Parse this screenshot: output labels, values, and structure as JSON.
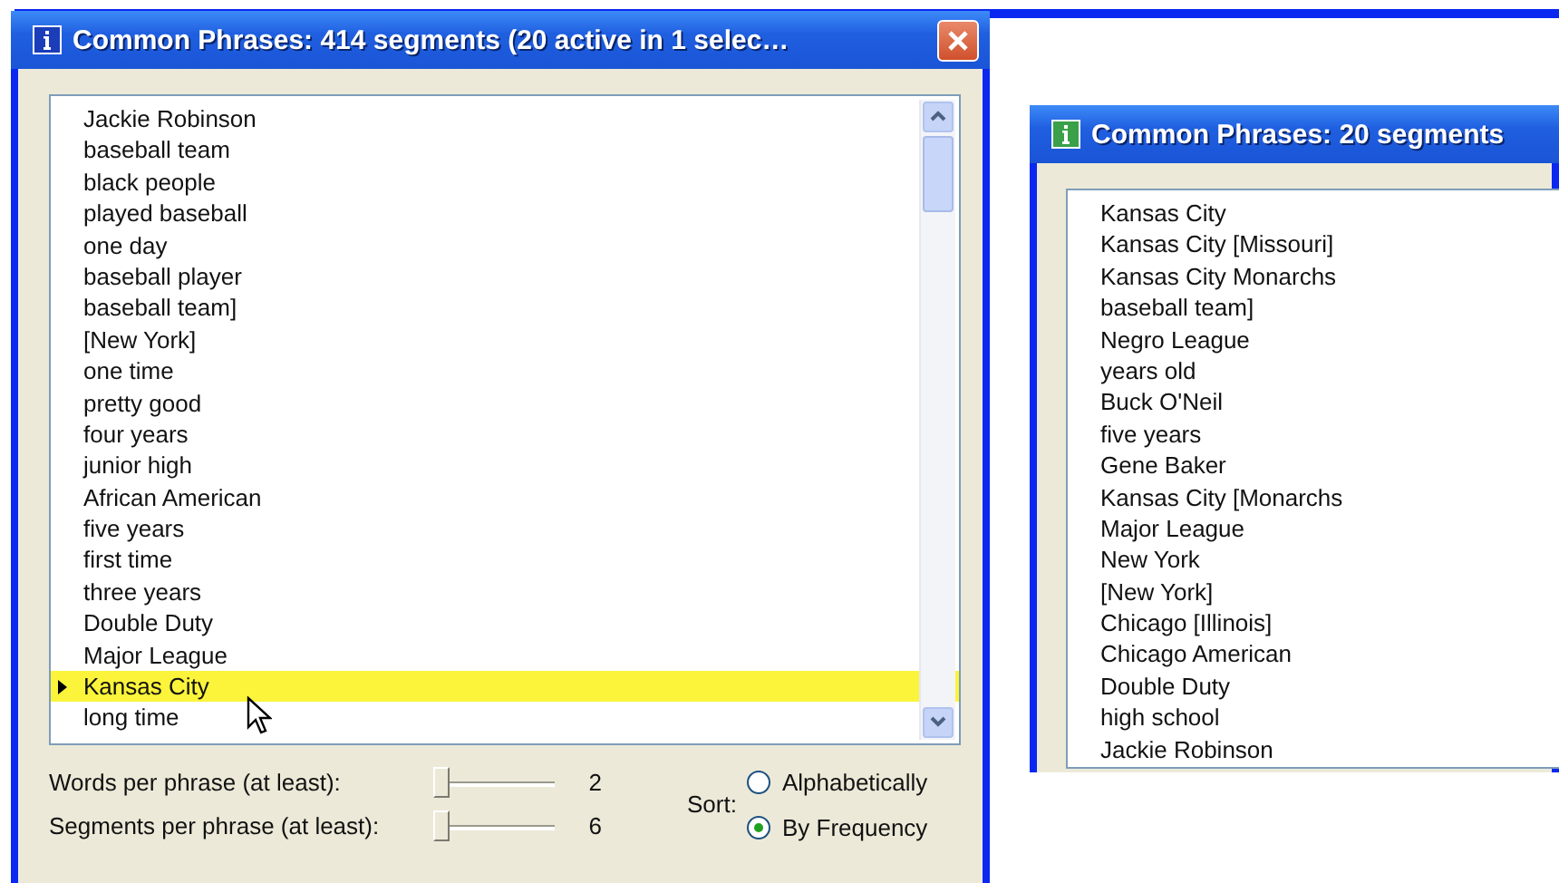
{
  "windows": [
    {
      "title": "Common Phrases: 414 segments (20 active in 1 selec…",
      "list": {
        "items": [
          {
            "text": "Jackie Robinson",
            "selected": false
          },
          {
            "text": "baseball team",
            "selected": false
          },
          {
            "text": "black people",
            "selected": false
          },
          {
            "text": "played baseball",
            "selected": false
          },
          {
            "text": "one day",
            "selected": false
          },
          {
            "text": "baseball player",
            "selected": false
          },
          {
            "text": "baseball team]",
            "selected": false
          },
          {
            "text": "[New York]",
            "selected": false
          },
          {
            "text": "one time",
            "selected": false
          },
          {
            "text": "pretty good",
            "selected": false
          },
          {
            "text": "four years",
            "selected": false
          },
          {
            "text": "junior high",
            "selected": false
          },
          {
            "text": "African American",
            "selected": false
          },
          {
            "text": "five years",
            "selected": false
          },
          {
            "text": "first time",
            "selected": false
          },
          {
            "text": "three years",
            "selected": false
          },
          {
            "text": "Double Duty",
            "selected": false
          },
          {
            "text": "Major League",
            "selected": false
          },
          {
            "text": "Kansas City",
            "selected": true
          },
          {
            "text": "long time",
            "selected": false
          }
        ]
      },
      "sliders": [
        {
          "label": "Words per phrase (at least):",
          "level": 0.0,
          "reading": "2"
        },
        {
          "label": "Segments per phrase (at least):",
          "level": 0.0,
          "reading": "6"
        }
      ],
      "sort": {
        "label": "Sort:",
        "options": [
          {
            "label": "Alphabetically",
            "selected": false
          },
          {
            "label": "By Frequency",
            "selected": true
          }
        ]
      }
    },
    {
      "title": "Common Phrases: 20 segments",
      "list": {
        "items": [
          {
            "text": "Kansas City",
            "selected": false
          },
          {
            "text": "Kansas City [Missouri]",
            "selected": false
          },
          {
            "text": "Kansas City Monarchs",
            "selected": false
          },
          {
            "text": "baseball team]",
            "selected": false
          },
          {
            "text": "Negro League",
            "selected": false
          },
          {
            "text": "years old",
            "selected": false
          },
          {
            "text": "Buck O'Neil",
            "selected": false
          },
          {
            "text": "five years",
            "selected": false
          },
          {
            "text": "Gene Baker",
            "selected": false
          },
          {
            "text": "Kansas City [Monarchs",
            "selected": false
          },
          {
            "text": "Major League",
            "selected": false
          },
          {
            "text": "New York",
            "selected": false
          },
          {
            "text": "[New York]",
            "selected": false
          },
          {
            "text": "Chicago [Illinois]",
            "selected": false
          },
          {
            "text": "Chicago American",
            "selected": false
          },
          {
            "text": "Double Duty",
            "selected": false
          },
          {
            "text": "high school",
            "selected": false
          },
          {
            "text": "Jackie Robinson",
            "selected": false
          }
        ]
      }
    }
  ]
}
